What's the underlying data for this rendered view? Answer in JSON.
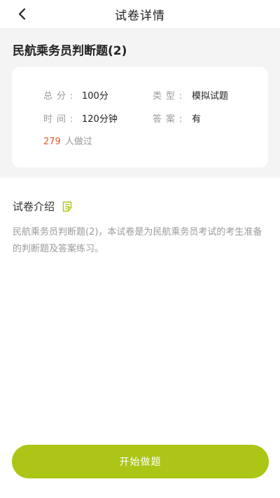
{
  "header": {
    "title": "试卷详情",
    "back_icon": "chevron-left-icon"
  },
  "paper": {
    "title": "民航乘务员判断题(2)"
  },
  "info": {
    "score_label": "总分:",
    "score_value": "100分",
    "type_label": "类型:",
    "type_value": "模拟试题",
    "time_label": "时间:",
    "time_value": "120分钟",
    "answer_label": "答案:",
    "answer_value": "有",
    "takers_count": "279",
    "takers_suffix": "人做过"
  },
  "intro": {
    "heading": "试卷介绍",
    "heading_icon": "document-note-icon",
    "text": "民航乘务员判断题(2)，本试卷是为民航乘务员考试的考生准备的判断题及答案练习。"
  },
  "actions": {
    "start_label": "开始做题"
  },
  "colors": {
    "accent": "#acc516",
    "count": "#e2582f",
    "muted": "#9a9a9a",
    "top_area_bg": "#f4f4f4"
  }
}
